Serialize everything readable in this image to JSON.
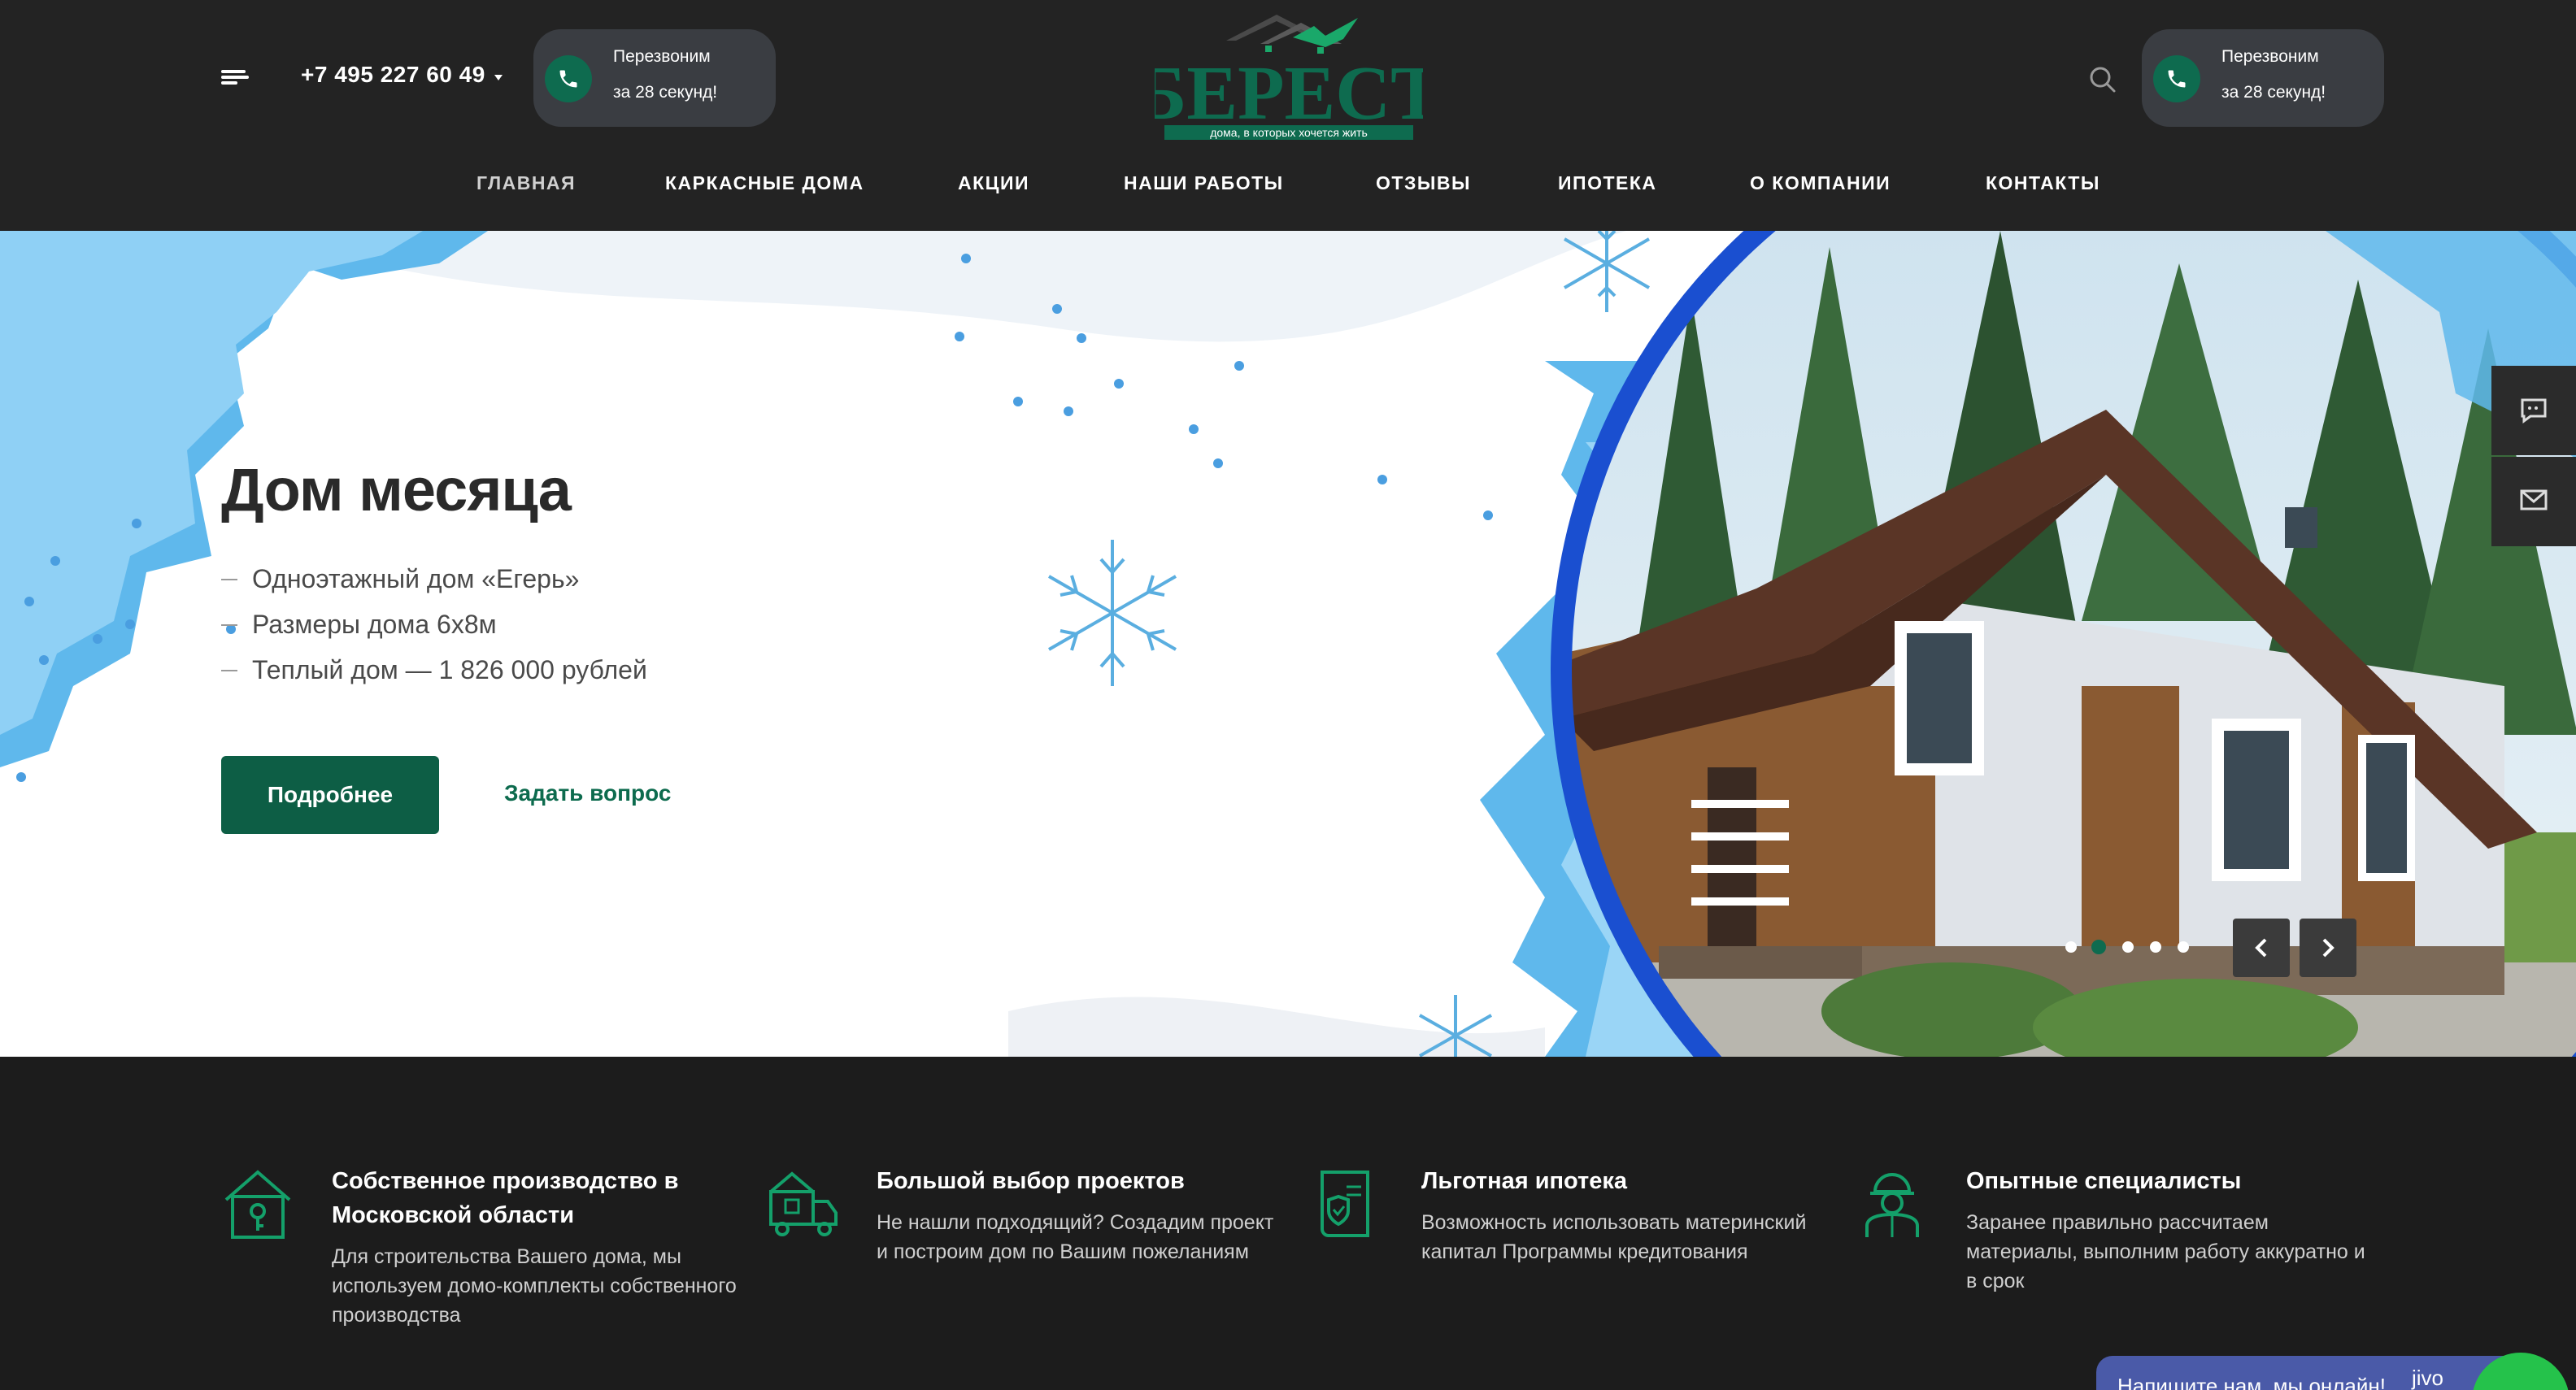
{
  "header": {
    "phone": "+7 495 227 60 49",
    "callback_left": {
      "line1": "Перезвоним",
      "line2": "за 28 секунд!"
    },
    "callback_right": {
      "line1": "Перезвоним",
      "line2": "за 28 секунд!"
    },
    "logo": {
      "brand": "БЕРЕСТ",
      "tagline": "дома, в которых хочется жить"
    },
    "nav": [
      {
        "label": "ГЛАВНАЯ"
      },
      {
        "label": "КАРКАСНЫЕ ДОМА"
      },
      {
        "label": "АКЦИИ"
      },
      {
        "label": "НАШИ РАБОТЫ"
      },
      {
        "label": "ОТЗЫВЫ"
      },
      {
        "label": "ИПОТЕКА"
      },
      {
        "label": "О КОМПАНИИ"
      },
      {
        "label": "КОНТАКТЫ"
      }
    ]
  },
  "hero": {
    "title": "Дом месяца",
    "items": [
      "Одноэтажный дом «Егерь»",
      "Размеры дома 6х8м",
      "Теплый дом — 1 826 000 рублей"
    ],
    "primary_button": "Подробнее",
    "secondary_button": "Задать вопрос",
    "slides_total": 5,
    "active_slide": 2
  },
  "features": [
    {
      "icon": "house-key-icon",
      "title": "Собственное производство в Московской области",
      "text": "Для строительства Вашего дома, мы используем домо-комплекты собственного производства"
    },
    {
      "icon": "truck-house-icon",
      "title": "Большой выбор проектов",
      "text": "Не нашли подходящий? Создадим проект и построим дом по Вашим пожеланиям"
    },
    {
      "icon": "document-shield-icon",
      "title": "Льготная ипотека",
      "text": "Возможность использовать материнский капитал Программы кредитования"
    },
    {
      "icon": "worker-icon",
      "title": "Опытные специалисты",
      "text": "Заранее правильно рассчитаем материалы, выполним работу аккуратно и в срок"
    }
  ],
  "chat": {
    "text": "Напишите нам, мы онлайн!",
    "brand": "jivo"
  },
  "colors": {
    "accent": "#0d5e45",
    "header_bg": "#232323",
    "features_bg": "#1c1c1c",
    "ice_blue": "#4aa8e0",
    "circle_blue": "#1a4fd0"
  }
}
